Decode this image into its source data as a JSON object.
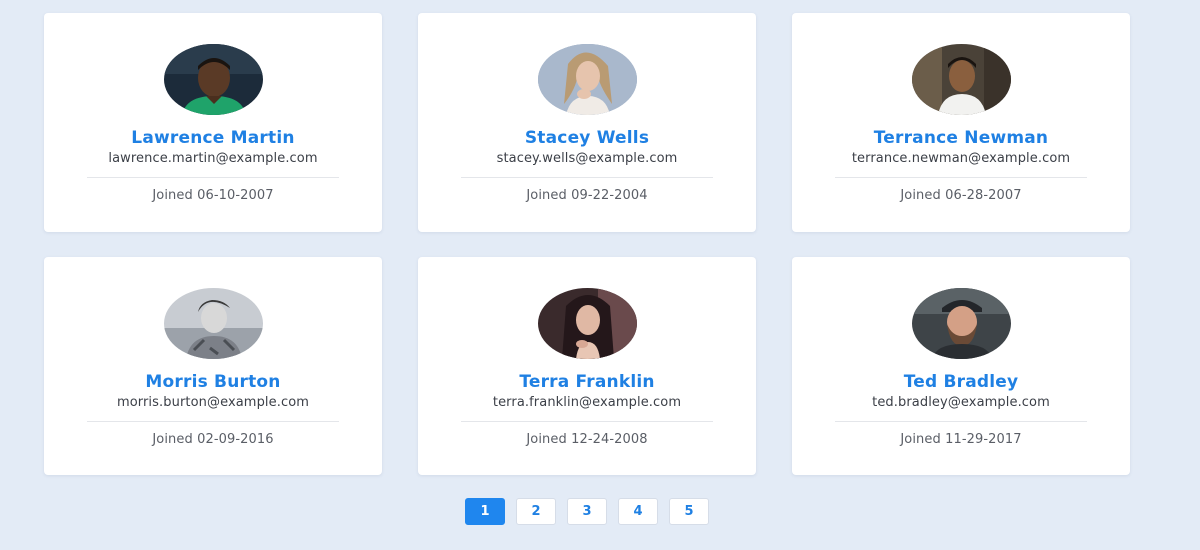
{
  "users": [
    {
      "name": "Lawrence Martin",
      "email": "lawrence.martin@example.com",
      "joined": "Joined 06-10-2007",
      "avatar_icon": "user-photo-man-green-shirt"
    },
    {
      "name": "Stacey Wells",
      "email": "stacey.wells@example.com",
      "joined": "Joined 09-22-2004",
      "avatar_icon": "user-photo-woman-blonde"
    },
    {
      "name": "Terrance Newman",
      "email": "terrance.newman@example.com",
      "joined": "Joined 06-28-2007",
      "avatar_icon": "user-photo-man-white-shirt"
    },
    {
      "name": "Morris Burton",
      "email": "morris.burton@example.com",
      "joined": "Joined 02-09-2016",
      "avatar_icon": "user-photo-man-grayscale"
    },
    {
      "name": "Terra Franklin",
      "email": "terra.franklin@example.com",
      "joined": "Joined 12-24-2008",
      "avatar_icon": "user-photo-woman-dark-hair"
    },
    {
      "name": "Ted Bradley",
      "email": "ted.bradley@example.com",
      "joined": "Joined 11-29-2017",
      "avatar_icon": "user-photo-man-beard-cap"
    }
  ],
  "pagination": {
    "pages": [
      "1",
      "2",
      "3",
      "4",
      "5"
    ],
    "current": "1"
  },
  "colors": {
    "background": "#e3ebf6",
    "accent": "#1f80e3",
    "active_page": "#1f86ee"
  }
}
